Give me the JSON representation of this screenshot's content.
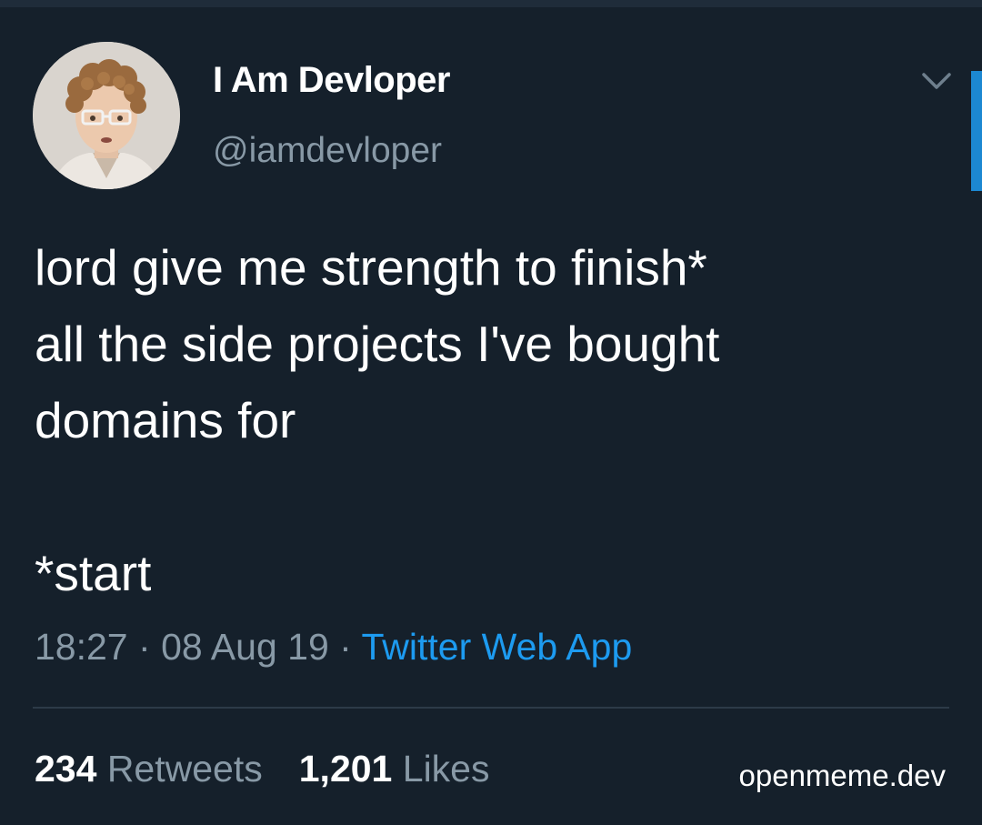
{
  "tweet": {
    "author": {
      "display_name": "I Am Devloper",
      "handle": "@iamdevloper",
      "avatar_icon": "avatar-person-glasses"
    },
    "text_lines": [
      "lord give me strength to finish*",
      "all the side projects I've bought",
      "domains for",
      "",
      "*start"
    ],
    "time": "18:27",
    "date": "08 Aug 19",
    "separator": "·",
    "source": "Twitter Web App",
    "stats": {
      "retweets_count": "234",
      "retweets_label": "Retweets",
      "likes_count": "1,201",
      "likes_label": "Likes"
    },
    "menu_icon": "chevron-down-icon"
  },
  "watermark": "openmeme.dev",
  "colors": {
    "background": "#15202b",
    "text_primary": "#ffffff",
    "text_secondary": "#8899a6",
    "accent": "#1d9bf0",
    "divider": "#2c3a48"
  }
}
